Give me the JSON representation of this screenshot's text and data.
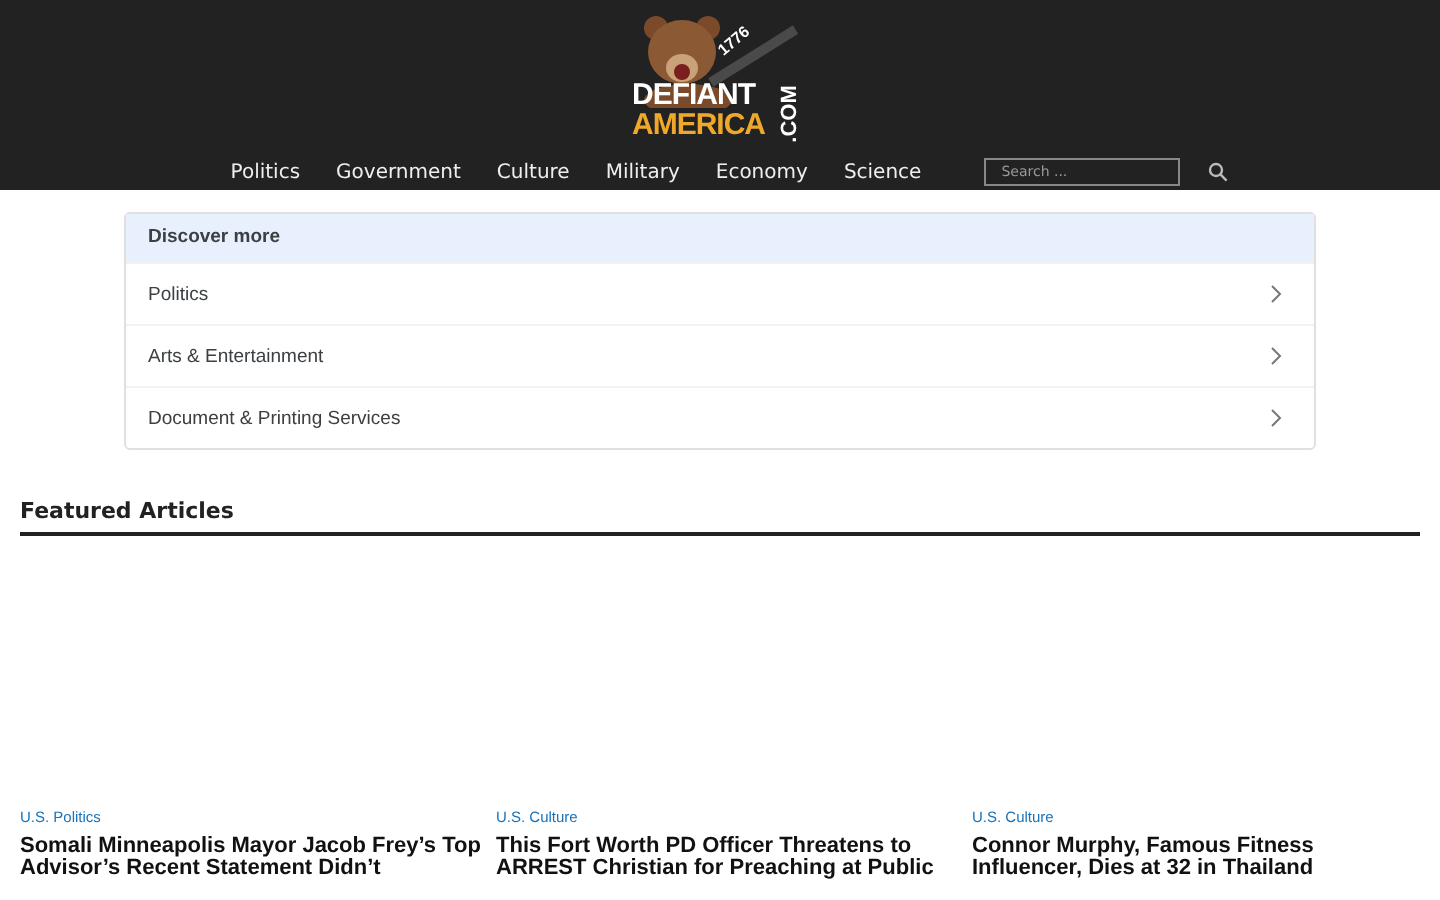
{
  "logo": {
    "line_1": "DEFIANT",
    "line_2": "AMERICA",
    "suffix": ".COM",
    "year": "1776"
  },
  "nav": {
    "items": [
      "Politics",
      "Government",
      "Culture",
      "Military",
      "Economy",
      "Science"
    ],
    "search": {
      "placeholder": "Search ..."
    }
  },
  "discover": {
    "title": "Discover more",
    "items": [
      "Politics",
      "Arts & Entertainment",
      "Document & Printing Services"
    ]
  },
  "featured": {
    "title": "Featured Articles",
    "articles": [
      {
        "category": "U.S. Politics",
        "title": "Somali Minneapolis Mayor Jacob Frey’s Top Advisor’s Recent Statement Didn’t"
      },
      {
        "category": "U.S. Culture",
        "title": "This Fort Worth PD Officer Threatens to ARREST Christian for Preaching at Public"
      },
      {
        "category": "U.S. Culture",
        "title": "Connor Murphy, Famous Fitness Influencer, Dies at 32 in Thailand"
      }
    ]
  }
}
